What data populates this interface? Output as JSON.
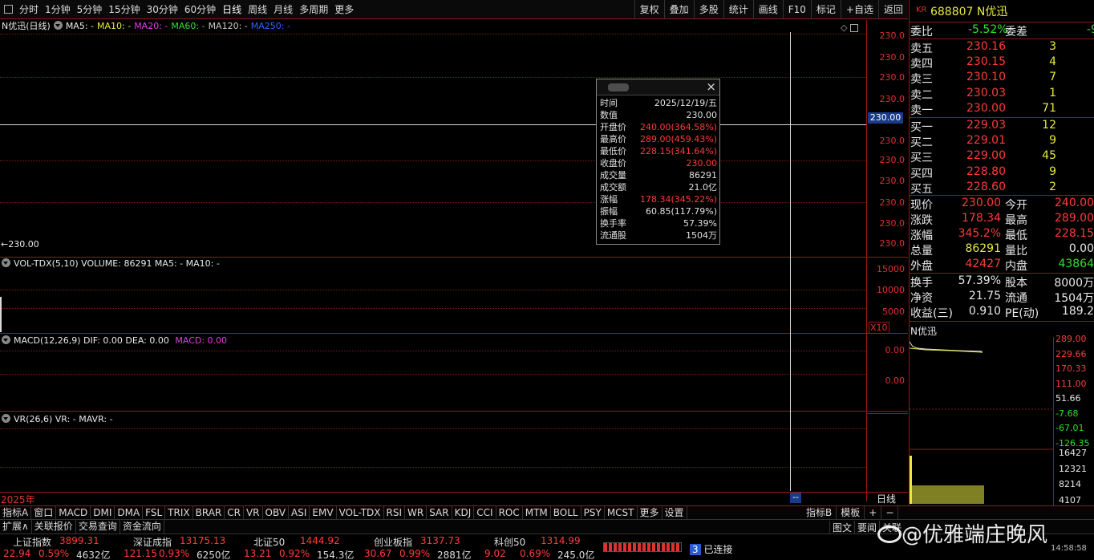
{
  "toolbar": {
    "periods": [
      "分时",
      "1分钟",
      "5分钟",
      "15分钟",
      "30分钟",
      "60分钟",
      "日线",
      "周线",
      "月线",
      "多周期",
      "更多"
    ],
    "right": [
      "复权",
      "叠加",
      "多股",
      "统计",
      "画线",
      "F10",
      "标记",
      "+自选",
      "返回"
    ]
  },
  "main_chart": {
    "title": "N优迅(日线)",
    "ma": [
      {
        "label": "MA5: -",
        "color": "#e8e8e8"
      },
      {
        "label": "MA10: -",
        "color": "#e8e840"
      },
      {
        "label": "MA20: -",
        "color": "#e040e0"
      },
      {
        "label": "MA60: -",
        "color": "#30e030"
      },
      {
        "label": "MA120: -",
        "color": "#c8c8c8"
      },
      {
        "label": "MA250: -",
        "color": "#3060ff"
      }
    ],
    "yticks": [
      "230.0",
      "230.0",
      "230.0",
      "230.0",
      "230.0",
      "230.0",
      "230.0",
      "230.0",
      "230.0",
      "230.0",
      "230.0"
    ],
    "current_price_tag": "230.00",
    "price_marker": "←230.00"
  },
  "vol_chart": {
    "title": "VOL-TDX(5,10) VOLUME: 86291 MA5: - MA10: -",
    "yticks": [
      "15000",
      "10000",
      "5000"
    ],
    "unit": "X10"
  },
  "macd_chart": {
    "title": "MACD(12,26,9) DIF: 0.00 DEA: 0.00",
    "macd_label": "MACD: 0.00",
    "yticks": [
      "0.00",
      "0.00"
    ]
  },
  "vr_chart": {
    "title": "VR(26,6) VR: - MAVR: -"
  },
  "x_axis": {
    "year": "2025年",
    "cursor": "--",
    "period": "日线"
  },
  "popup": {
    "rows": [
      {
        "k": "时间",
        "v": "2025/12/19/五",
        "c": "#e0e0e0"
      },
      {
        "k": "数值",
        "v": "230.00",
        "c": "#e0e0e0"
      },
      {
        "k": "开盘价",
        "v": "240.00(364.58%)",
        "c": "#ff3b3b"
      },
      {
        "k": "最高价",
        "v": "289.00(459.43%)",
        "c": "#ff3b3b"
      },
      {
        "k": "最低价",
        "v": "228.15(341.64%)",
        "c": "#ff3b3b"
      },
      {
        "k": "收盘价",
        "v": "230.00",
        "c": "#ff3b3b"
      },
      {
        "k": "成交量",
        "v": "86291",
        "c": "#e0e0e0"
      },
      {
        "k": "成交额",
        "v": "21.0亿",
        "c": "#e0e0e0"
      },
      {
        "k": "涨幅",
        "v": "178.34(345.22%)",
        "c": "#ff3b3b"
      },
      {
        "k": "振幅",
        "v": "60.85(117.79%)",
        "c": "#e0e0e0"
      },
      {
        "k": "换手率",
        "v": "57.39%",
        "c": "#e0e0e0"
      },
      {
        "k": "流通股",
        "v": "1504万",
        "c": "#e0e0e0"
      }
    ]
  },
  "quote": {
    "market": "KR",
    "code": "688807",
    "name": "N优迅",
    "weibi_label": "委比",
    "weibi": "-5.52%",
    "weicha_label": "委差",
    "weicha": "-9",
    "sells": [
      {
        "label": "卖五",
        "price": "230.16",
        "vol": "3"
      },
      {
        "label": "卖四",
        "price": "230.15",
        "vol": "4"
      },
      {
        "label": "卖三",
        "price": "230.10",
        "vol": "7"
      },
      {
        "label": "卖二",
        "price": "230.03",
        "vol": "1"
      },
      {
        "label": "卖一",
        "price": "230.00",
        "vol": "71"
      }
    ],
    "buys": [
      {
        "label": "买一",
        "price": "229.03",
        "vol": "12"
      },
      {
        "label": "买二",
        "price": "229.01",
        "vol": "9"
      },
      {
        "label": "买三",
        "price": "229.00",
        "vol": "45"
      },
      {
        "label": "买四",
        "price": "228.80",
        "vol": "9"
      },
      {
        "label": "买五",
        "price": "228.60",
        "vol": "2"
      }
    ],
    "stats": [
      {
        "l1": "现价",
        "v1": "230.00",
        "c1": "#ff3b3b",
        "l2": "今开",
        "v2": "240.00",
        "c2": "#ff3b3b"
      },
      {
        "l1": "涨跌",
        "v1": "178.34",
        "c1": "#ff3b3b",
        "l2": "最高",
        "v2": "289.00",
        "c2": "#ff3b3b"
      },
      {
        "l1": "涨幅",
        "v1": "345.2%",
        "c1": "#ff3b3b",
        "l2": "最低",
        "v2": "228.15",
        "c2": "#ff3b3b"
      },
      {
        "l1": "总量",
        "v1": "86291",
        "c1": "#e8e840",
        "l2": "量比",
        "v2": "0.00",
        "c2": "#e8e8e8"
      },
      {
        "l1": "外盘",
        "v1": "42427",
        "c1": "#ff3b3b",
        "l2": "内盘",
        "v2": "43864",
        "c2": "#2ee02e"
      }
    ],
    "stats2": [
      {
        "l1": "换手",
        "v1": "57.39%",
        "l2": "股本",
        "v2": "8000万"
      },
      {
        "l1": "净资",
        "v1": "21.75",
        "l2": "流通",
        "v2": "1504万"
      },
      {
        "l1": "收益(三)",
        "v1": "0.910",
        "l2": "PE(动)",
        "v2": "189.2"
      }
    ]
  },
  "mini_chart": {
    "title": "N优迅",
    "price_ticks": [
      {
        "v": "289.00",
        "c": "#ff3b3b"
      },
      {
        "v": "229.66",
        "c": "#ff3b3b"
      },
      {
        "v": "170.33",
        "c": "#ff3b3b"
      },
      {
        "v": "111.00",
        "c": "#ff3b3b"
      },
      {
        "v": "51.66",
        "c": "#e8e8e8"
      },
      {
        "v": "-7.68",
        "c": "#2ee02e"
      },
      {
        "v": "-67.01",
        "c": "#2ee02e"
      },
      {
        "v": "-126.35",
        "c": "#2ee02e"
      }
    ],
    "vol_ticks": [
      "16427",
      "12321",
      "8214",
      "4107"
    ]
  },
  "indicator_tabs": [
    "指标A",
    "窗口",
    "MACD",
    "DMI",
    "DMA",
    "FSL",
    "TRIX",
    "BRAR",
    "CR",
    "VR",
    "OBV",
    "ASI",
    "EMV",
    "VOL-TDX",
    "RSI",
    "WR",
    "SAR",
    "KDJ",
    "CCI",
    "ROC",
    "MTM",
    "BOLL",
    "PSY",
    "MCST",
    "更多",
    "设置"
  ],
  "indicator_right": [
    "指标B",
    "模板",
    "+",
    "−"
  ],
  "bottom_tabs": [
    "扩展∧",
    "关联报价",
    "交易查询",
    "资金流向"
  ],
  "bottom_right": [
    "图文",
    "要闻",
    "关联"
  ],
  "indices": [
    {
      "name": "上证指数",
      "value": "3899.31",
      "chg": "22.94",
      "pct": "0.59%",
      "amt": "4632亿"
    },
    {
      "name": "深证成指",
      "value": "13175.13",
      "chg": "121.15",
      "pct": "0.93%",
      "amt": "6250亿"
    },
    {
      "name": "北证50",
      "value": "1444.92",
      "chg": "13.21",
      "pct": "0.92%",
      "amt": "154.3亿"
    },
    {
      "name": "创业板指",
      "value": "3137.73",
      "chg": "30.67",
      "pct": "0.99%",
      "amt": "2881亿"
    },
    {
      "name": "科创50",
      "value": "1314.99",
      "chg": "9.02",
      "pct": "0.69%",
      "amt": "245.0亿"
    }
  ],
  "connection": {
    "count": "3",
    "label": "已连接"
  },
  "watermark": "@优雅端庄晚风",
  "clock": "14:58:58"
}
